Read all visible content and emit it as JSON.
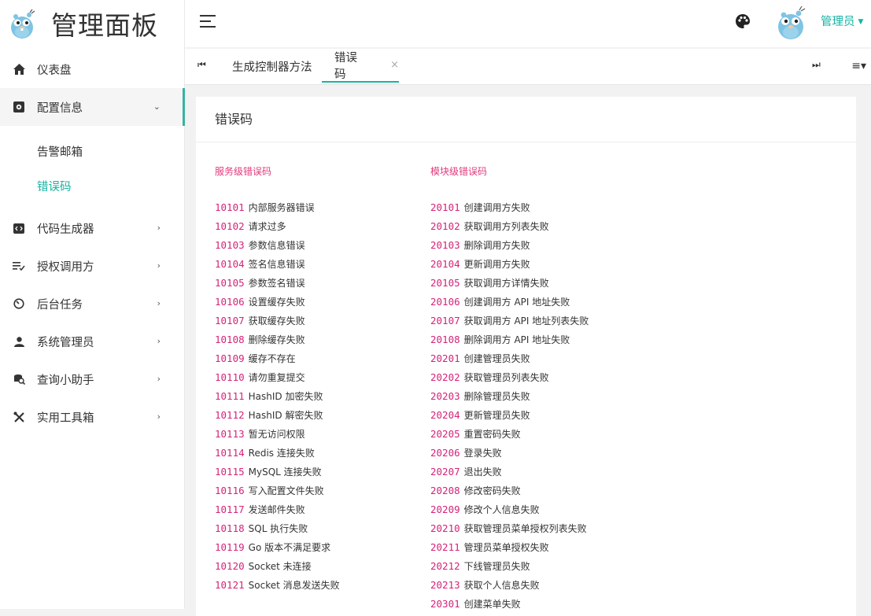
{
  "brand": {
    "title": "管理面板"
  },
  "sidebar": {
    "items": [
      {
        "label": "仪表盘"
      },
      {
        "label": "配置信息",
        "open": true,
        "children": [
          {
            "label": "告警邮箱"
          },
          {
            "label": "错误码",
            "active": true
          }
        ]
      },
      {
        "label": "代码生成器"
      },
      {
        "label": "授权调用方"
      },
      {
        "label": "后台任务"
      },
      {
        "label": "系统管理员"
      },
      {
        "label": "查询小助手"
      },
      {
        "label": "实用工具箱"
      }
    ]
  },
  "header": {
    "user": "管理员"
  },
  "tabs": [
    {
      "label": "生成控制器方法"
    },
    {
      "label": "错误码",
      "active": true,
      "close": "×"
    }
  ],
  "card": {
    "title": "错误码",
    "service": {
      "title": "服务级错误码",
      "rows": [
        {
          "code": "10101",
          "text": "内部服务器错误"
        },
        {
          "code": "10102",
          "text": "请求过多"
        },
        {
          "code": "10103",
          "text": "参数信息错误"
        },
        {
          "code": "10104",
          "text": "签名信息错误"
        },
        {
          "code": "10105",
          "text": "参数签名错误"
        },
        {
          "code": "10106",
          "text": "设置缓存失败"
        },
        {
          "code": "10107",
          "text": "获取缓存失败"
        },
        {
          "code": "10108",
          "text": "删除缓存失败"
        },
        {
          "code": "10109",
          "text": "缓存不存在"
        },
        {
          "code": "10110",
          "text": "请勿重复提交"
        },
        {
          "code": "10111",
          "text": "HashID 加密失败"
        },
        {
          "code": "10112",
          "text": "HashID 解密失败"
        },
        {
          "code": "10113",
          "text": "暂无访问权限"
        },
        {
          "code": "10114",
          "text": "Redis 连接失败"
        },
        {
          "code": "10115",
          "text": "MySQL 连接失败"
        },
        {
          "code": "10116",
          "text": "写入配置文件失败"
        },
        {
          "code": "10117",
          "text": "发送邮件失败"
        },
        {
          "code": "10118",
          "text": "SQL 执行失败"
        },
        {
          "code": "10119",
          "text": "Go 版本不满足要求"
        },
        {
          "code": "10120",
          "text": "Socket 未连接"
        },
        {
          "code": "10121",
          "text": "Socket 消息发送失败"
        }
      ]
    },
    "module": {
      "title": "模块级错误码",
      "rows": [
        {
          "code": "20101",
          "text": "创建调用方失败"
        },
        {
          "code": "20102",
          "text": "获取调用方列表失败"
        },
        {
          "code": "20103",
          "text": "删除调用方失败"
        },
        {
          "code": "20104",
          "text": "更新调用方失败"
        },
        {
          "code": "20105",
          "text": "获取调用方详情失败"
        },
        {
          "code": "20106",
          "text": "创建调用方 API 地址失败"
        },
        {
          "code": "20107",
          "text": "获取调用方 API 地址列表失败"
        },
        {
          "code": "20108",
          "text": "删除调用方 API 地址失败"
        },
        {
          "code": "20201",
          "text": "创建管理员失败"
        },
        {
          "code": "20202",
          "text": "获取管理员列表失败"
        },
        {
          "code": "20203",
          "text": "删除管理员失败"
        },
        {
          "code": "20204",
          "text": "更新管理员失败"
        },
        {
          "code": "20205",
          "text": "重置密码失败"
        },
        {
          "code": "20206",
          "text": "登录失败"
        },
        {
          "code": "20207",
          "text": "退出失败"
        },
        {
          "code": "20208",
          "text": "修改密码失败"
        },
        {
          "code": "20209",
          "text": "修改个人信息失败"
        },
        {
          "code": "20210",
          "text": "获取管理员菜单授权列表失败"
        },
        {
          "code": "20211",
          "text": "管理员菜单授权失败"
        },
        {
          "code": "20212",
          "text": "下线管理员失败"
        },
        {
          "code": "20213",
          "text": "获取个人信息失败"
        },
        {
          "code": "20301",
          "text": "创建菜单失败"
        }
      ]
    }
  }
}
